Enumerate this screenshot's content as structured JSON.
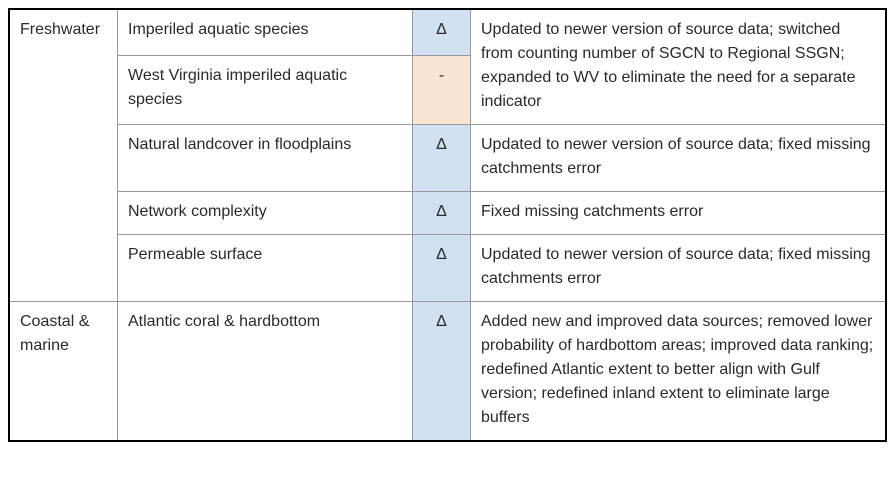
{
  "categories": [
    {
      "id": "freshwater",
      "label": "Freshwater"
    },
    {
      "id": "coastal-marine",
      "label": "Coastal & marine"
    }
  ],
  "rows": {
    "r1": {
      "indicator": "Imperiled aquatic species",
      "symbol": "Δ"
    },
    "r2": {
      "indicator": "West Virginia imperiled aquatic species",
      "symbol": "-"
    },
    "r1r2_desc": "Updated to newer version of source data; switched from counting number of SGCN to Regional SSGN; expanded to WV to eliminate the need for a separate indicator",
    "r3": {
      "indicator": "Natural landcover in floodplains",
      "symbol": "Δ",
      "desc": "Updated to newer version of source data; fixed missing catchments error"
    },
    "r4": {
      "indicator": "Network complexity",
      "symbol": "Δ",
      "desc": "Fixed missing catchments error"
    },
    "r5": {
      "indicator": "Permeable surface",
      "symbol": "Δ",
      "desc": "Updated to newer version of source data; fixed missing catchments error"
    },
    "r6": {
      "indicator": "Atlantic coral & hardbottom",
      "symbol": "Δ",
      "desc": "Added new and improved data sources; removed lower probability of hardbottom areas; improved data ranking; redefined Atlantic extent to better align with Gulf version; redefined inland extent to eliminate large buffers"
    }
  }
}
